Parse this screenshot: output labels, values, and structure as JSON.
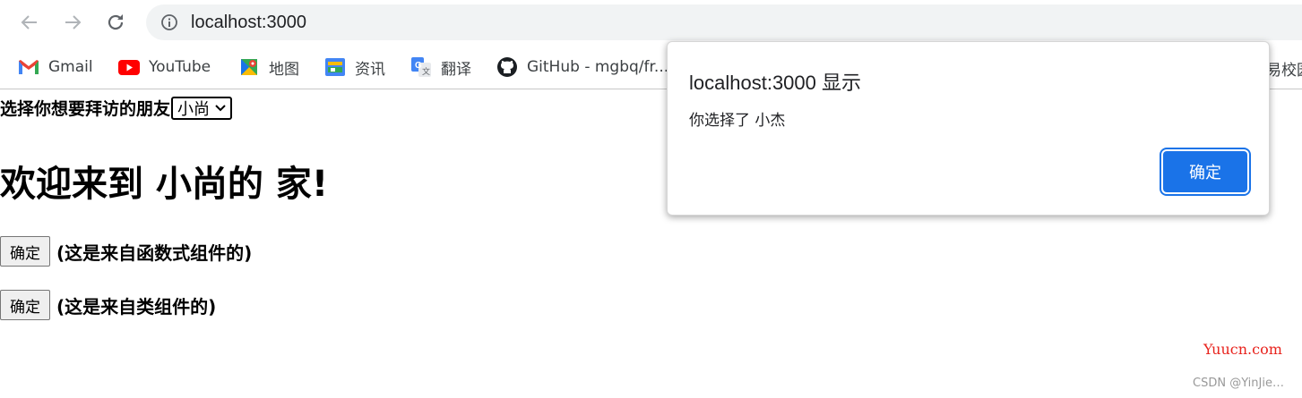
{
  "browser": {
    "url": "localhost:3000",
    "bookmarks": [
      {
        "label": "Gmail",
        "icon": "gmail-icon"
      },
      {
        "label": "YouTube",
        "icon": "youtube-icon"
      },
      {
        "label": "地图",
        "icon": "maps-icon"
      },
      {
        "label": "资讯",
        "icon": "news-icon"
      },
      {
        "label": "翻译",
        "icon": "translate-icon"
      },
      {
        "label": "GitHub - mgbq/fr...",
        "icon": "github-icon"
      }
    ],
    "bookmark_overflow": "易校园"
  },
  "page": {
    "select_label": "选择你想要拜访的朋友",
    "select_value": "小尚",
    "heading": "欢迎来到 小尚的 家!",
    "button_label": "确定",
    "function_note": "(这是来自函数式组件的)",
    "class_note": "(这是来自类组件的)"
  },
  "dialog": {
    "title": "localhost:3000 显示",
    "message": "你选择了 小杰",
    "ok_label": "确定"
  },
  "watermark": "Yuucn.com",
  "credit": "CSDN @YinJie…",
  "colors": {
    "accent": "#1a73e8",
    "watermark": "#e8221c"
  }
}
